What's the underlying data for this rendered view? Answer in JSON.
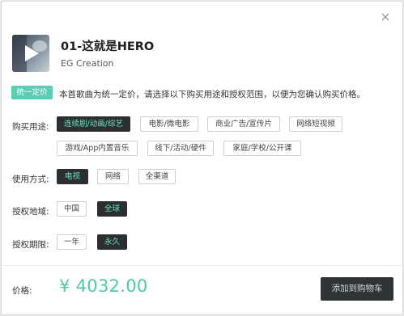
{
  "track": {
    "title": "01-这就是HERO",
    "artist": "EG Creation"
  },
  "badge": "统一定价",
  "notice": "本首歌曲为统一定价，请选择以下购买用途和授权范围，以便为您确认购买价格。",
  "usage": {
    "label": "购买用途:",
    "options": [
      "连续剧/动画/综艺",
      "电影/微电影",
      "商业广告/宣传片",
      "网络短视频",
      "游戏/App内置音乐",
      "线下/活动/硬件",
      "家庭/学校/公开课"
    ],
    "selected": "连续剧/动画/综艺"
  },
  "method": {
    "label": "使用方式:",
    "options": [
      "电视",
      "网络",
      "全渠道"
    ],
    "selected": "电视"
  },
  "region": {
    "label": "授权地域:",
    "options": [
      "中国",
      "全球"
    ],
    "selected": "全球"
  },
  "period": {
    "label": "授权期限:",
    "options": [
      "一年",
      "永久"
    ],
    "selected": "永久"
  },
  "price": {
    "label": "价格:",
    "value": "¥ 4032.00"
  },
  "cart_button": "添加到购物车",
  "colors": {
    "accent": "#5ccdb3",
    "selected_bg": "#2b2f31",
    "selected_text": "#6fe0c2",
    "price": "#4fc9a6"
  },
  "icons": {
    "close": "close-icon",
    "play": "play-icon"
  }
}
